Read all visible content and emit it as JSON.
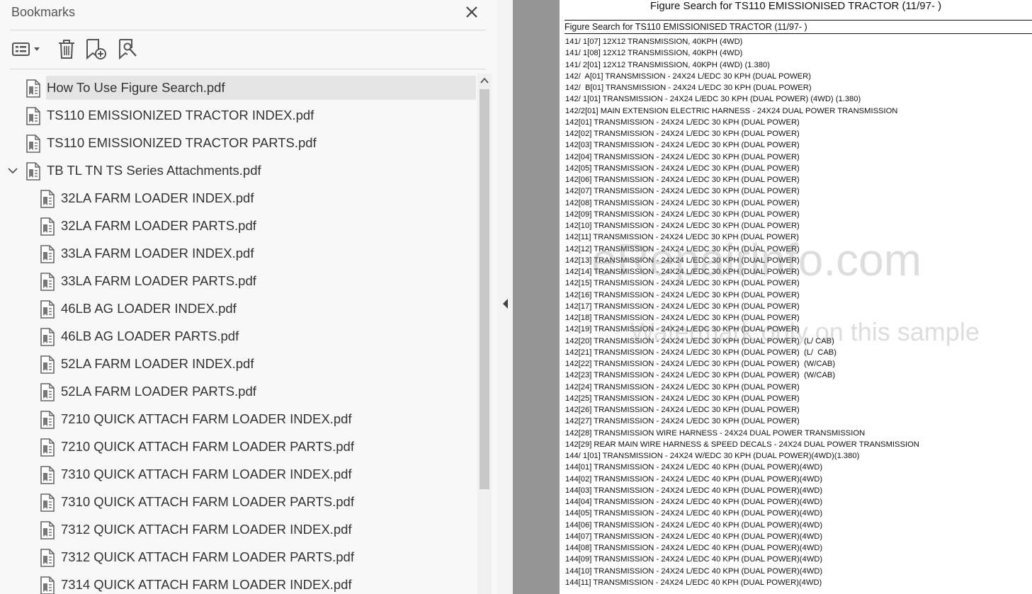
{
  "panel": {
    "title": "Bookmarks",
    "toolbar": [
      "options-menu",
      "delete-bookmark",
      "new-bookmark",
      "bookmark-search"
    ]
  },
  "bookmarks": [
    {
      "label": "How To Use Figure Search.pdf",
      "level": 0,
      "selected": true
    },
    {
      "label": "TS110 EMISSIONIZED TRACTOR INDEX.pdf",
      "level": 0
    },
    {
      "label": "TS110 EMISSIONIZED TRACTOR PARTS.pdf",
      "level": 0
    },
    {
      "label": "TB TL TN TS Series Attachments.pdf",
      "level": 0,
      "expanded": true
    },
    {
      "label": "32LA FARM LOADER INDEX.pdf",
      "level": 1
    },
    {
      "label": "32LA FARM LOADER PARTS.pdf",
      "level": 1
    },
    {
      "label": "33LA FARM LOADER INDEX.pdf",
      "level": 1
    },
    {
      "label": "33LA FARM LOADER PARTS.pdf",
      "level": 1
    },
    {
      "label": "46LB AG LOADER INDEX.pdf",
      "level": 1
    },
    {
      "label": "46LB AG LOADER PARTS.pdf",
      "level": 1
    },
    {
      "label": "52LA FARM LOADER INDEX.pdf",
      "level": 1
    },
    {
      "label": "52LA FARM LOADER PARTS.pdf",
      "level": 1
    },
    {
      "label": "7210 QUICK ATTACH FARM LOADER INDEX.pdf",
      "level": 1
    },
    {
      "label": "7210 QUICK ATTACH FARM LOADER PARTS.pdf",
      "level": 1
    },
    {
      "label": "7310 QUICK ATTACH FARM LOADER INDEX.pdf",
      "level": 1
    },
    {
      "label": "7310 QUICK ATTACH FARM LOADER PARTS.pdf",
      "level": 1
    },
    {
      "label": "7312 QUICK ATTACH FARM LOADER INDEX.pdf",
      "level": 1
    },
    {
      "label": "7312 QUICK ATTACH FARM LOADER PARTS.pdf",
      "level": 1
    },
    {
      "label": "7314 QUICK ATTACH FARM LOADER INDEX.pdf",
      "level": 1
    }
  ],
  "document": {
    "heading": "Figure Search for TS110 EMISSIONISED TRACTOR (11/97- )",
    "table_title": "Figure Search for TS110 EMISSIONISED TRACTOR (11/97- )",
    "lines": [
      "141/ 1[07] 12X12 TRANSMISSION, 40KPH (4WD)",
      "141/ 1[08] 12X12 TRANSMISSION, 40KPH (4WD)",
      "141/ 2[01] 12X12 TRANSMISSION, 40KPH (4WD) (1.380)",
      "142/  A[01] TRANSMISSION - 24X24 L/EDC 30 KPH (DUAL POWER)",
      "142/  B[01] TRANSMISSION - 24X24 L/EDC 30 KPH (DUAL POWER)",
      "142/ 1[01] TRANSMISSION - 24X24 L/EDC 30 KPH (DUAL POWER) (4WD) (1.380)",
      "142/2[01] MAIN EXTENSION ELECTRIC HARNESS - 24X24 DUAL POWER TRANSMISSION",
      "142[01] TRANSMISSION - 24X24 L/EDC 30 KPH (DUAL POWER)",
      "142[02] TRANSMISSION - 24X24 L/EDC 30 KPH (DUAL POWER)",
      "142[03] TRANSMISSION - 24X24 L/EDC 30 KPH (DUAL POWER)",
      "142[04] TRANSMISSION - 24X24 L/EDC 30 KPH (DUAL POWER)",
      "142[05] TRANSMISSION - 24X24 L/EDC 30 KPH (DUAL POWER)",
      "142[06] TRANSMISSION - 24X24 L/EDC 30 KPH (DUAL POWER)",
      "142[07] TRANSMISSION - 24X24 L/EDC 30 KPH (DUAL POWER)",
      "142[08] TRANSMISSION - 24X24 L/EDC 30 KPH (DUAL POWER)",
      "142[09] TRANSMISSION - 24X24 L/EDC 30 KPH (DUAL POWER)",
      "142[10] TRANSMISSION - 24X24 L/EDC 30 KPH (DUAL POWER)",
      "142[11] TRANSMISSION - 24X24 L/EDC 30 KPH (DUAL POWER)",
      "142[12] TRANSMISSION - 24X24 L/EDC 30 KPH (DUAL POWER)",
      "142[13] TRANSMISSION - 24X24 L/EDC 30 KPH (DUAL POWER)",
      "142[14] TRANSMISSION - 24X24 L/EDC 30 KPH (DUAL POWER)",
      "142[15] TRANSMISSION - 24X24 L/EDC 30 KPH (DUAL POWER)",
      "142[16] TRANSMISSION - 24X24 L/EDC 30 KPH (DUAL POWER)",
      "142[17] TRANSMISSION - 24X24 L/EDC 30 KPH (DUAL POWER)",
      "142[18] TRANSMISSION - 24X24 L/EDC 30 KPH (DUAL POWER)",
      "142[19] TRANSMISSION - 24X24 L/EDC 30 KPH (DUAL POWER)",
      "142[20] TRANSMISSION - 24X24 L/EDC 30 KPH (DUAL POWER)  (L/ CAB)",
      "142[21] TRANSMISSION - 24X24 L/EDC 30 KPH (DUAL POWER)  (L/  CAB)",
      "142[22] TRANSMISSION - 24X24 L/EDC 30 KPH (DUAL POWER)  (W/CAB)",
      "142[23] TRANSMISSION - 24X24 L/EDC 30 KPH (DUAL POWER)  (W/CAB)",
      "142[24] TRANSMISSION - 24X24 L/EDC 30 KPH (DUAL POWER)",
      "142[25] TRANSMISSION - 24X24 L/EDC 30 KPH (DUAL POWER)",
      "142[26] TRANSMISSION - 24X24 L/EDC 30 KPH (DUAL POWER)",
      "142[27] TRANSMISSION - 24X24 L/EDC 30 KPH (DUAL POWER)",
      "142[28] TRANSMISSION WIRE HARNESS - 24X24 DUAL POWER TRANSMISSION",
      "142[29] REAR MAIN WIRE HARNESS & SPEED DECALS - 24X24 DUAL POWER TRANSMISSION",
      "144/ 1[01] TRANSMISSION - 24X24 W/EDC 30 KPH (DUAL POWER)(4WD)(1.380)",
      "144[01] TRANSMISSION - 24X24 L/EDC 40 KPH (DUAL POWER)(4WD)",
      "144[02] TRANSMISSION - 24X24 L/EDC 40 KPH (DUAL POWER)(4WD)",
      "144[03] TRANSMISSION - 24X24 L/EDC 40 KPH (DUAL POWER)(4WD)",
      "144[04] TRANSMISSION - 24X24 L/EDC 40 KPH (DUAL POWER)(4WD)",
      "144[05] TRANSMISSION - 24X24 L/EDC 40 KPH (DUAL POWER)(4WD)",
      "144[06] TRANSMISSION - 24X24 L/EDC 40 KPH (DUAL POWER)(4WD)",
      "144[07] TRANSMISSION - 24X24 L/EDC 40 KPH (DUAL POWER)(4WD)",
      "144[08] TRANSMISSION - 24X24 L/EDC 40 KPH (DUAL POWER)(4WD)",
      "144[09] TRANSMISSION - 24X24 L/EDC 40 KPH (DUAL POWER)(4WD)",
      "144[10] TRANSMISSION - 24X24 L/EDC 40 KPH (DUAL POWER)(4WD)",
      "144[11] TRANSMISSION - 24X24 L/EDC 40 KPH (DUAL POWER)(4WD)"
    ]
  },
  "watermark": {
    "site": "eRepairinfo.com",
    "note": "Watermark only on this sample"
  }
}
